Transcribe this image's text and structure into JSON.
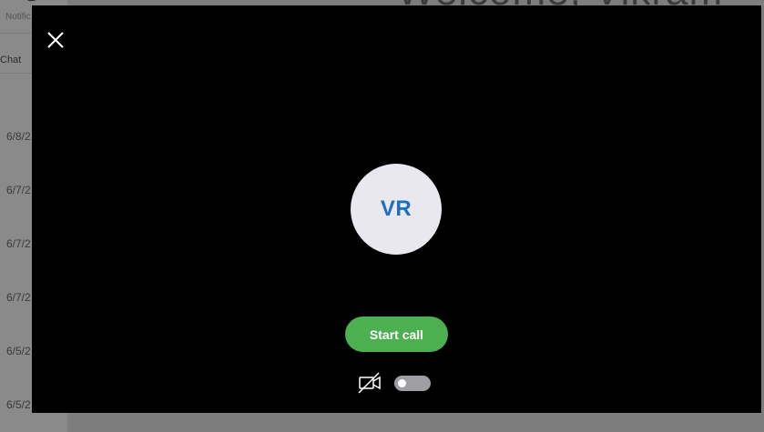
{
  "background": {
    "sidebar_title": "ٹ",
    "notifications_label": "Notific",
    "chat_filter_label": "Chat",
    "welcome_text": "Welcome, Vikram",
    "dates": [
      "6/8/2",
      "6/7/2",
      "6/7/2",
      "6/7/2",
      "6/5/2",
      "6/5/2"
    ]
  },
  "modal": {
    "avatar_initials": "VR",
    "start_call_label": "Start call",
    "video_toggle_on": false
  },
  "colors": {
    "modal_bg": "#000000",
    "start_call_green": "#4caf50",
    "avatar_bg": "#e8e8ee",
    "initials_blue": "#1f6fbd",
    "toggle_off": "#9e9ea3"
  },
  "icons": [
    "close-icon",
    "video-off-icon",
    "chevron-down-icon"
  ]
}
